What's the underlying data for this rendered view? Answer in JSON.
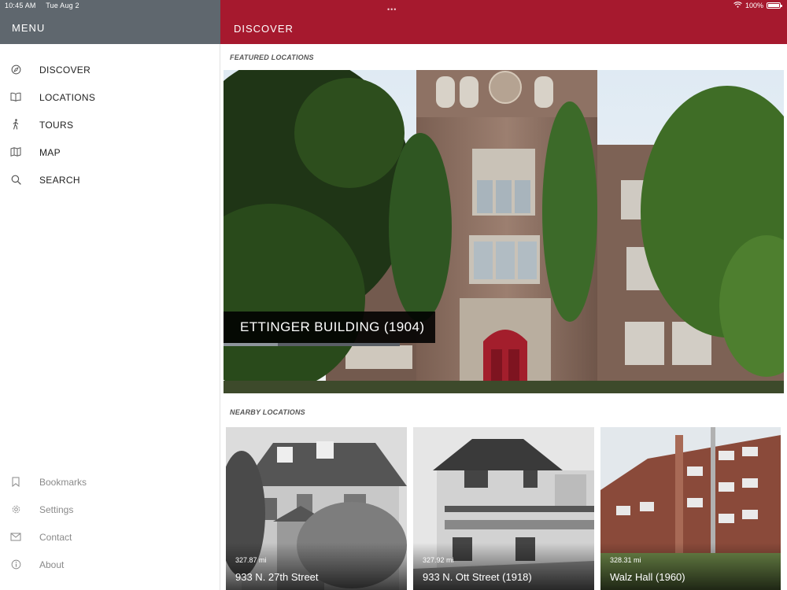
{
  "status_bar": {
    "time": "10:45 AM",
    "date": "Tue Aug 2",
    "battery": "100%",
    "multitask_dots": "•••"
  },
  "sidebar": {
    "title": "MENU",
    "primary_items": [
      {
        "label": "DISCOVER",
        "icon": "compass-icon"
      },
      {
        "label": "LOCATIONS",
        "icon": "book-icon"
      },
      {
        "label": "TOURS",
        "icon": "walking-person-icon"
      },
      {
        "label": "MAP",
        "icon": "map-icon"
      },
      {
        "label": "SEARCH",
        "icon": "search-icon"
      }
    ],
    "secondary_items": [
      {
        "label": "Bookmarks",
        "icon": "bookmark-icon"
      },
      {
        "label": "Settings",
        "icon": "gear-icon"
      },
      {
        "label": "Contact",
        "icon": "envelope-icon"
      },
      {
        "label": "About",
        "icon": "info-icon"
      }
    ]
  },
  "header": {
    "title": "DISCOVER",
    "color": "#a6192e"
  },
  "featured": {
    "section_label": "FEATURED LOCATIONS",
    "caption": "ETTINGER BUILDING (1904)",
    "carousel_progress": 0.31
  },
  "nearby": {
    "section_label": "NEARBY LOCATIONS",
    "items": [
      {
        "distance": "327.87 mi",
        "name": "933 N. 27th Street"
      },
      {
        "distance": "327.92 mi",
        "name": "933 N. Ott Street (1918)"
      },
      {
        "distance": "328.31 mi",
        "name": "Walz Hall (1960)"
      }
    ]
  },
  "colors": {
    "sidebar_header": "#5f676e",
    "accent": "#a6192e"
  }
}
